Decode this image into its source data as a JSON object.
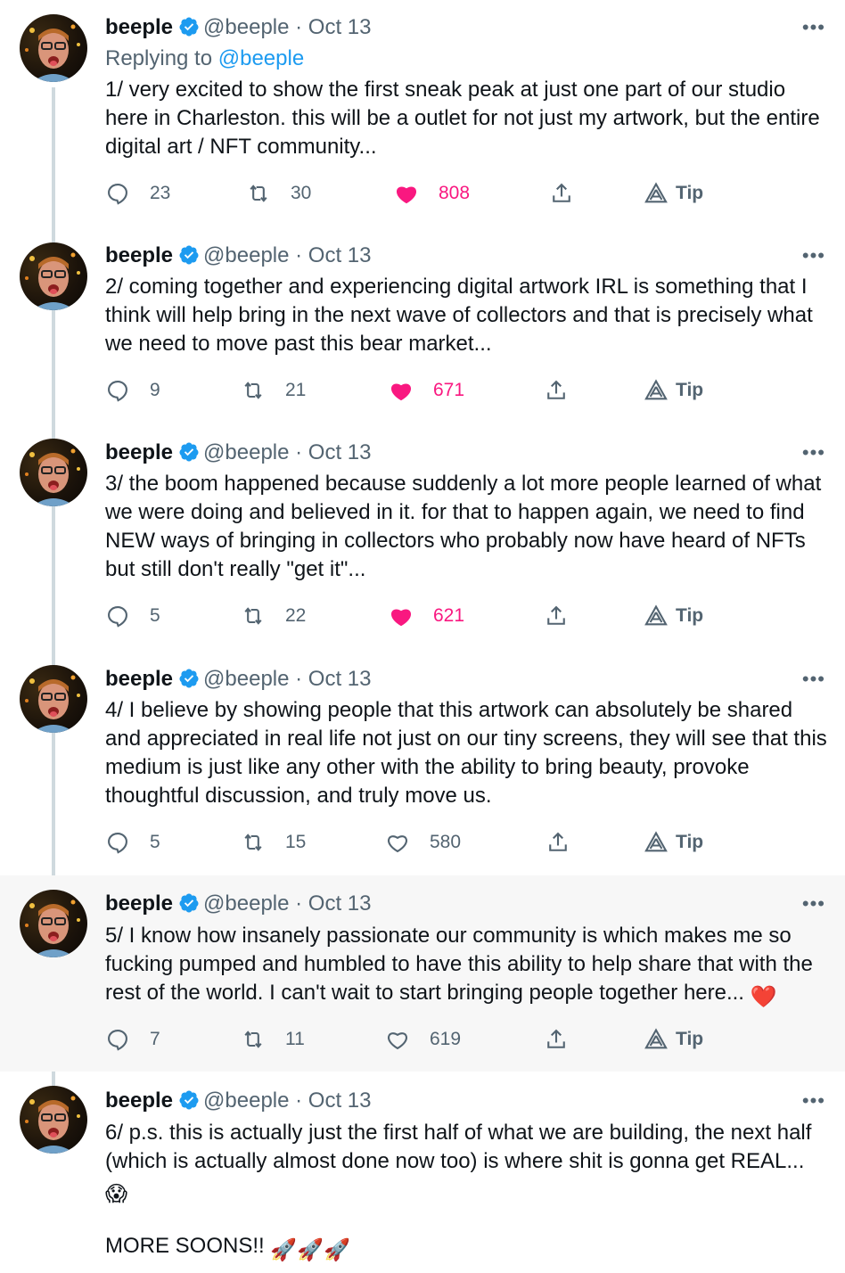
{
  "thread": [
    {
      "name": "beeple",
      "handle": "@beeple",
      "date": "Oct 13",
      "replying_prefix": "Replying to",
      "replying_handle": "@beeple",
      "text": "1/ very excited to show the first sneak peak at just one part of our studio here in Charleston.  this will be a outlet for not just my artwork, but the entire digital art / NFT community...",
      "replies": "23",
      "retweets": "30",
      "likes": "808",
      "liked": true,
      "tip": "Tip"
    },
    {
      "name": "beeple",
      "handle": "@beeple",
      "date": "Oct 13",
      "text": "2/ coming together and experiencing digital artwork IRL is something that I think will help bring in the next wave of collectors and that is precisely what we need to move past this bear market...",
      "replies": "9",
      "retweets": "21",
      "likes": "671",
      "liked": true,
      "tip": "Tip"
    },
    {
      "name": "beeple",
      "handle": "@beeple",
      "date": "Oct 13",
      "text": "3/ the boom happened because suddenly a lot more people learned of what we were doing and believed in it.  for that to happen again, we need to find NEW ways of bringing in collectors who probably now have heard of NFTs but still don't really \"get it\"...",
      "replies": "5",
      "retweets": "22",
      "likes": "621",
      "liked": true,
      "tip": "Tip"
    },
    {
      "name": "beeple",
      "handle": "@beeple",
      "date": "Oct 13",
      "text": "4/ I believe by showing people that this artwork can absolutely be shared and appreciated in real life not just on our tiny screens, they will see that this medium is just like any other with the ability to bring beauty, provoke thoughtful discussion, and truly move us.",
      "replies": "5",
      "retweets": "15",
      "likes": "580",
      "liked": false,
      "tip": "Tip"
    },
    {
      "name": "beeple",
      "handle": "@beeple",
      "date": "Oct 13",
      "text": "5/ I know how insanely passionate our community is which makes me so fucking pumped and humbled to have this ability to help share that with the rest of the world.  I can't wait to start bringing people together here...",
      "text_emoji": "❤️",
      "replies": "7",
      "retweets": "11",
      "likes": "619",
      "liked": false,
      "tip": "Tip"
    },
    {
      "name": "beeple",
      "handle": "@beeple",
      "date": "Oct 13",
      "text": "6/  p.s. this is actually just the first half of what we are building, the next half (which is actually almost done now too) is where shit is gonna get REAL...",
      "text_emoji": "😱",
      "text2": "MORE SOONS!!",
      "text2_emoji": "🚀🚀🚀"
    }
  ],
  "colors": {
    "like": "#f91880",
    "link": "#1d9bf0",
    "muted": "#536471",
    "thread_line": "#cfd9de",
    "highlight_bg": "#f7f7f7"
  }
}
